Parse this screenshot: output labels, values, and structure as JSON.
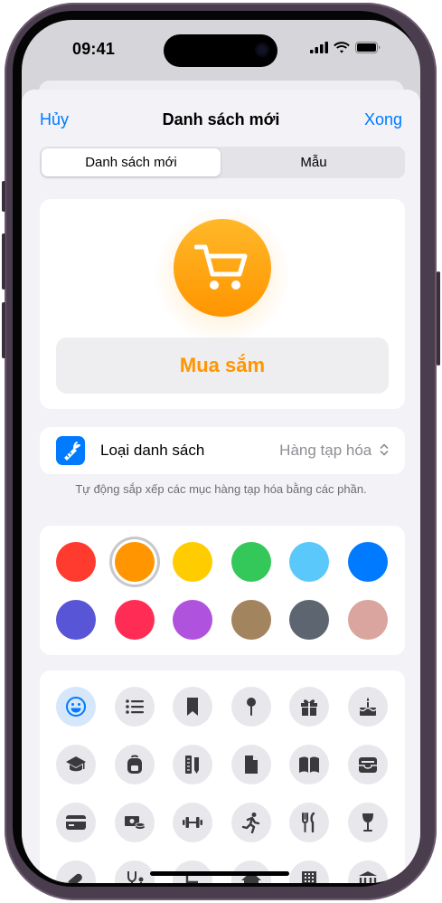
{
  "status_bar": {
    "time": "09:41"
  },
  "nav": {
    "cancel_label": "Hủy",
    "title": "Danh sách mới",
    "done_label": "Xong"
  },
  "segment": {
    "options": [
      "Danh sách mới",
      "Mẫu"
    ],
    "selected": "Danh sách mới"
  },
  "list": {
    "icon": "cart-icon",
    "name": "Mua sắm",
    "color": "#ff9500"
  },
  "list_type": {
    "icon": "carrot-icon",
    "label": "Loại danh sách",
    "value": "Hàng tạp hóa",
    "hint": "Tự động sắp xếp các mục hàng tạp hóa bằng các phần."
  },
  "colors": {
    "swatches": [
      "#ff3b30",
      "#ff9500",
      "#ffcc00",
      "#34c759",
      "#5ac8fa",
      "#007aff",
      "#5856d6",
      "#ff2d55",
      "#af52de",
      "#a2845e",
      "#5d6670",
      "#d9a59e"
    ],
    "selected_index": 1
  },
  "icons": {
    "items": [
      "smiley-icon",
      "list-icon",
      "bookmark-icon",
      "pin-icon",
      "gift-icon",
      "birthday-cake-icon",
      "graduation-cap-icon",
      "backpack-icon",
      "ruler-pencil-icon",
      "document-icon",
      "book-icon",
      "wallet-icon",
      "credit-card-icon",
      "money-icon",
      "dumbbell-icon",
      "running-icon",
      "fork-knife-icon",
      "wine-glass-icon",
      "pills-icon",
      "stethoscope-icon",
      "chair-icon",
      "house-icon",
      "building-icon",
      "bank-icon"
    ],
    "selected_index": 0
  }
}
